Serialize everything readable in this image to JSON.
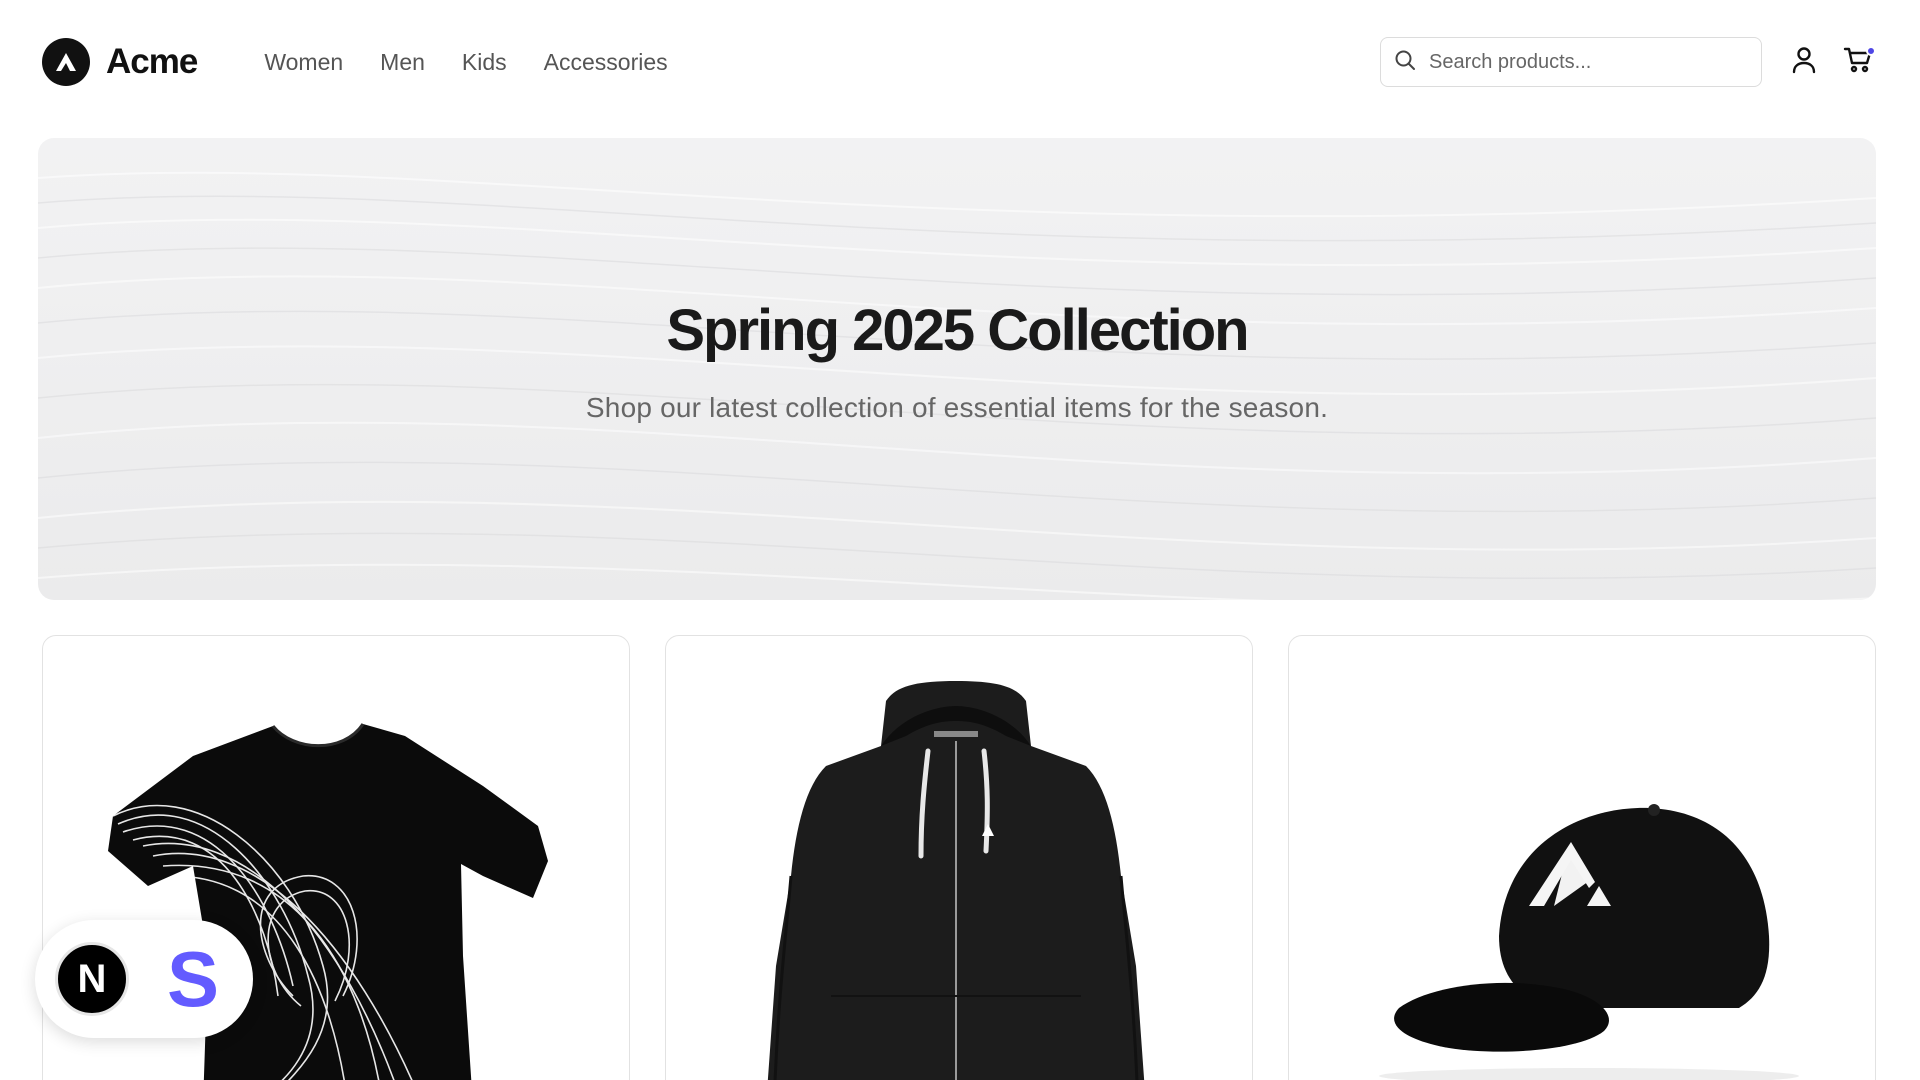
{
  "brand": {
    "name": "Acme",
    "logo_icon": "acme-triangle-logo-icon"
  },
  "nav": {
    "items": [
      {
        "label": "Women"
      },
      {
        "label": "Men"
      },
      {
        "label": "Kids"
      },
      {
        "label": "Accessories"
      }
    ]
  },
  "search": {
    "placeholder": "Search products...",
    "icon": "search-icon"
  },
  "header_actions": {
    "account_icon": "user-icon",
    "cart_icon": "cart-icon",
    "cart_indicator_color": "#4f46e5"
  },
  "hero": {
    "title": "Spring 2025 Collection",
    "subtitle": "Shop our latest collection of essential items for the season."
  },
  "products": [
    {
      "image": "black-t-shirt-with-line-graphic"
    },
    {
      "image": "black-zip-hoodie"
    },
    {
      "image": "black-baseball-cap-with-logo"
    }
  ],
  "badge": {
    "left_letter": "N",
    "right_letter": "S",
    "right_color": "#635bff"
  }
}
